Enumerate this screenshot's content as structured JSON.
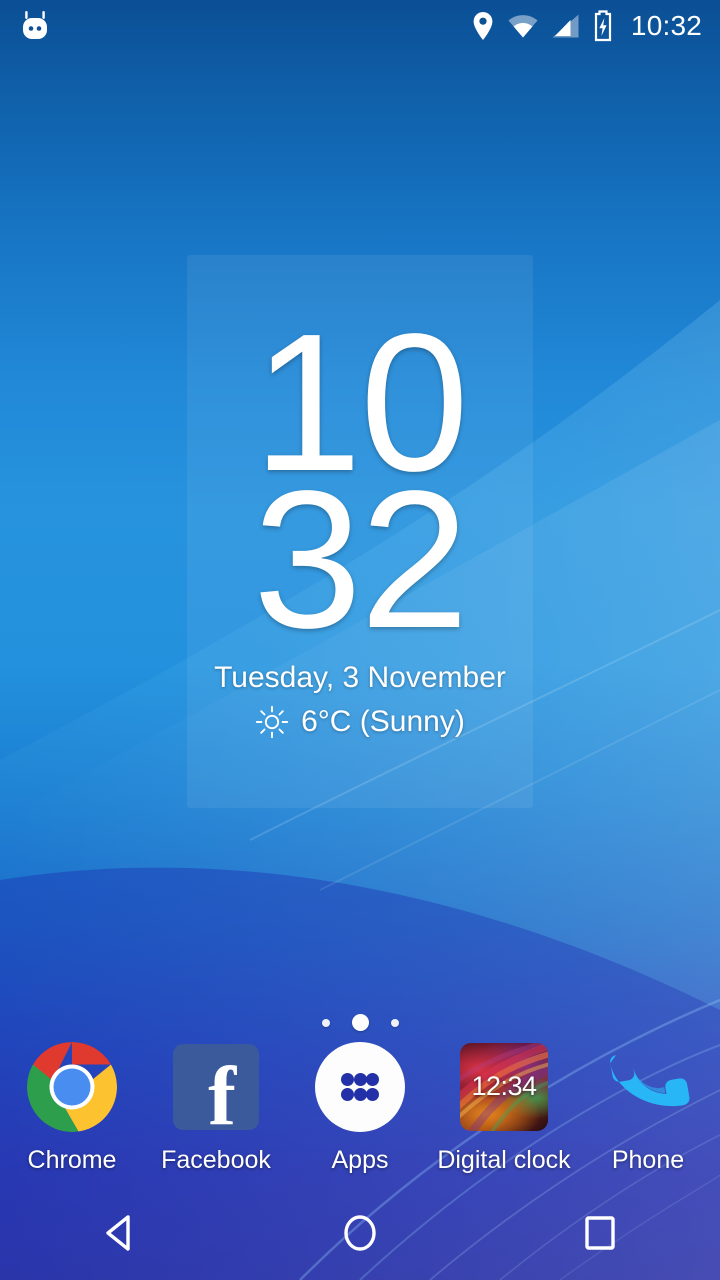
{
  "statusbar": {
    "notification_icon": "android-mascot-icon",
    "icons": [
      "location-pin-icon",
      "wifi-icon",
      "cellular-signal-icon",
      "battery-charging-icon"
    ],
    "time": "10:32"
  },
  "clock_widget": {
    "hours": "10",
    "minutes": "32",
    "date": "Tuesday, 3 November",
    "weather_icon": "sunny-icon",
    "weather": "6°C (Sunny)"
  },
  "page_indicator": {
    "count": 3,
    "active_index": 1
  },
  "dock": {
    "items": [
      {
        "label": "Chrome",
        "icon": "chrome-icon"
      },
      {
        "label": "Facebook",
        "icon": "facebook-icon"
      },
      {
        "label": "Apps",
        "icon": "apps-drawer-icon"
      },
      {
        "label": "Digital clock",
        "icon": "digital-clock-icon",
        "tile_time": "12:34"
      },
      {
        "label": "Phone",
        "icon": "phone-icon"
      }
    ]
  },
  "navbar": {
    "back": "back-nav-button",
    "home": "home-nav-button",
    "recents": "recents-nav-button"
  },
  "colors": {
    "wallpaper_top": "#0b4f95",
    "wallpaper_mid": "#2793de",
    "wallpaper_bottom": "#2b2a9e",
    "accent_white": "#ffffff",
    "facebook_blue": "#3a5a9b",
    "phone_blue": "#29b6f6"
  }
}
